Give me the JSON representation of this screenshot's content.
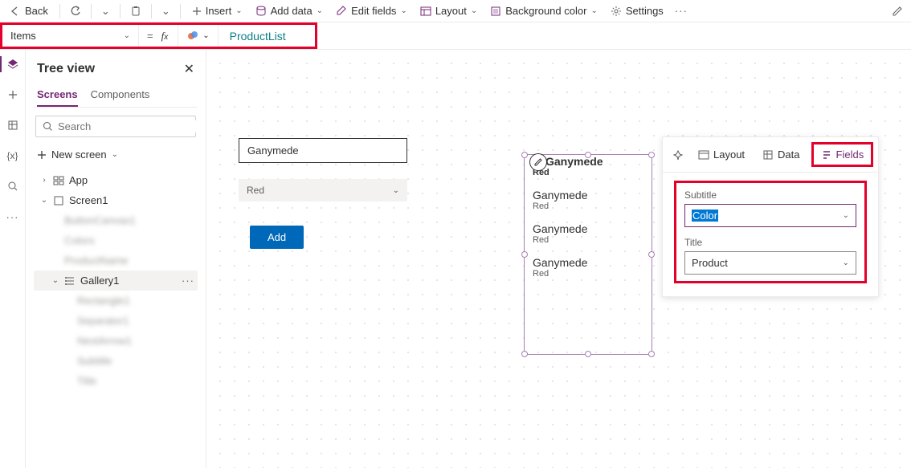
{
  "commandbar": {
    "back": "Back",
    "insert": "Insert",
    "add_data": "Add data",
    "edit_fields": "Edit fields",
    "layout": "Layout",
    "bg_color": "Background color",
    "settings": "Settings"
  },
  "formula": {
    "property": "Items",
    "expression": "ProductList"
  },
  "tree": {
    "title": "Tree view",
    "tabs": {
      "screens": "Screens",
      "components": "Components"
    },
    "search_placeholder": "Search",
    "new_screen": "New screen",
    "items": {
      "app": "App",
      "screen1": "Screen1",
      "gallery1": "Gallery1",
      "b0": "ButtonCanvas1",
      "b1": "Colors",
      "b2": "ProductName",
      "b3": "Rectangle1",
      "b4": "Separator1",
      "b5": "NextArrow1",
      "b6": "Subtitle",
      "b7": "Title"
    }
  },
  "stage": {
    "textbox": "Ganymede",
    "dropdown": "Red",
    "add_button": "Add"
  },
  "gallery": {
    "items": [
      {
        "title": "Ganymede",
        "sub": "Red"
      },
      {
        "title": "Ganymede",
        "sub": "Red"
      },
      {
        "title": "Ganymede",
        "sub": "Red"
      },
      {
        "title": "Ganymede",
        "sub": "Red"
      }
    ]
  },
  "prop_pane": {
    "tabs": {
      "layout": "Layout",
      "data": "Data",
      "fields": "Fields"
    },
    "subtitle_label": "Subtitle",
    "subtitle_value": "Color",
    "title_label": "Title",
    "title_value": "Product"
  }
}
